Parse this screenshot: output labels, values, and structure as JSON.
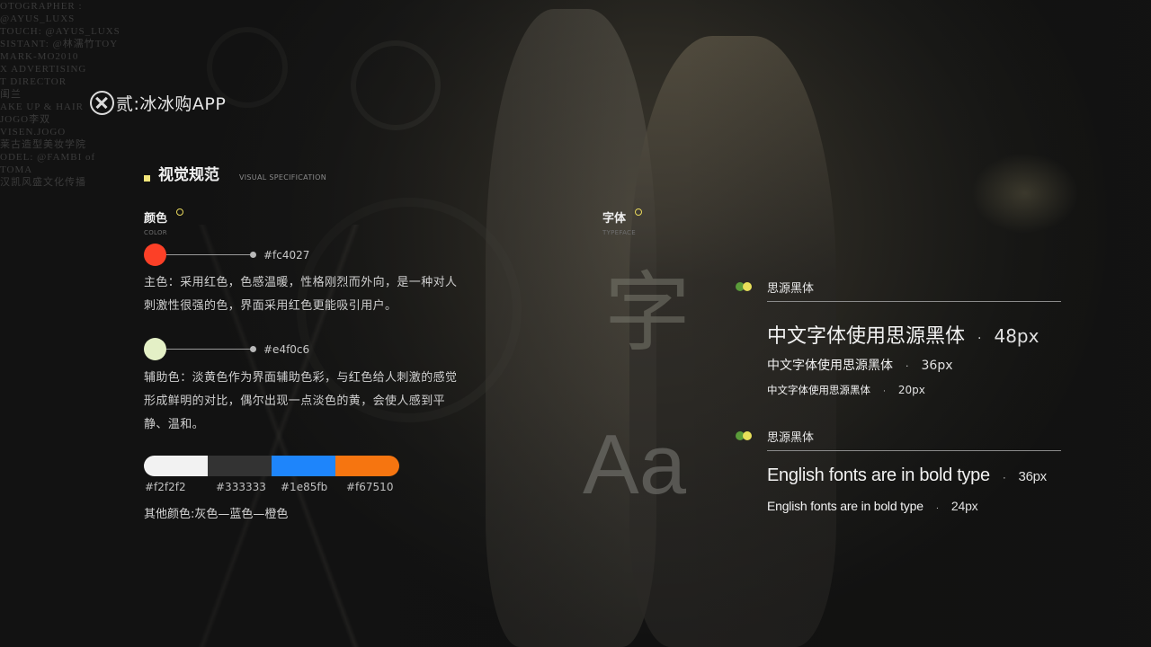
{
  "background": {
    "credits": [
      "OTOGRAPHER : @AYUS_LUXS",
      "TOUCH: @AYUS_LUXS",
      "SISTANT: @林濡竹TOY",
      "MARK-MO2010",
      "X ADVERTISING",
      "",
      "T DIRECTOR",
      "闺兰",
      "",
      "AKE UP & HAIR",
      "JOGO李双",
      "VISEN.JOGO",
      "莱古造型美妆学院",
      "",
      "ODEL: @FAMBI of TOMA",
      "汉凯风盛文化传播"
    ]
  },
  "header": {
    "title": "贰:冰冰购APP"
  },
  "section": {
    "title_cn": "视觉规范",
    "title_en": "VISUAL SPECIFICATION"
  },
  "color": {
    "label_cn": "颜色",
    "label_en": "COLOR",
    "primary": {
      "hex": "#fc4027",
      "color": "#fc4027",
      "desc_lines": [
        "主色：采用红色，色感温暖，性格刚烈而外向，是一种对人",
        "刺激性很强的色，界面采用红色更能吸引用户。"
      ]
    },
    "secondary": {
      "hex": "#e4f0c6",
      "color": "#e4f0c6",
      "desc_lines": [
        "辅助色：淡黄色作为界面辅助色彩，与红色给人刺激的感觉",
        "形成鲜明的对比，偶尔出现一点淡色的黄，会使人感到平",
        "静、温和。"
      ]
    },
    "others": {
      "swatches": [
        {
          "hex": "#f2f2f2",
          "color": "#f2f2f2"
        },
        {
          "hex": "#333333",
          "color": "#333333"
        },
        {
          "hex": "#1e85fb",
          "color": "#1e85fb"
        },
        {
          "hex": "#f67510",
          "color": "#f67510"
        }
      ],
      "caption": "其他颜色:灰色—蓝色—橙色"
    }
  },
  "typeface": {
    "label_cn": "字体",
    "label_en": "TYPEFACE",
    "sample_cn_glyph": "字",
    "sample_en_glyph": "Aa",
    "groups": [
      {
        "name": "思源黑体",
        "samples": [
          {
            "text": "中文字体使用思源黑体",
            "sep": "·",
            "size": "48px"
          },
          {
            "text": "中文字体使用思源黑体",
            "sep": "·",
            "size": "36px"
          },
          {
            "text": "中文字体使用思源黑体",
            "sep": "·",
            "size": "20px"
          }
        ]
      },
      {
        "name": "思源黑体",
        "samples": [
          {
            "text": "English fonts are in bold type",
            "sep": "·",
            "size": "36px"
          },
          {
            "text": "English fonts are in bold type",
            "sep": "·",
            "size": "24px"
          }
        ]
      }
    ]
  }
}
